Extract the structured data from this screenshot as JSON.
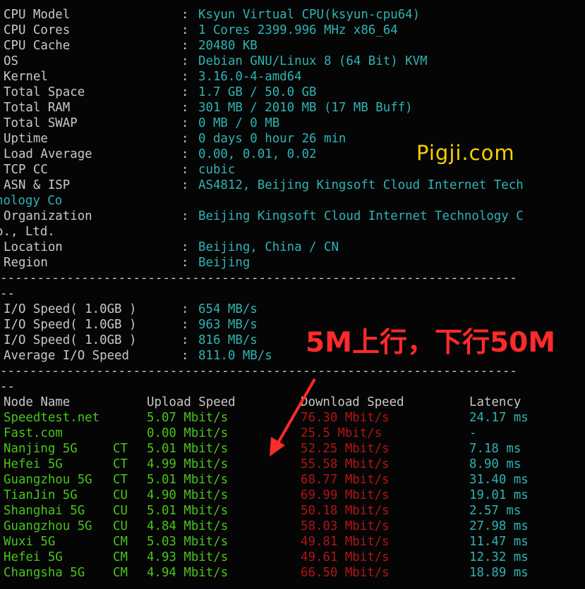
{
  "colors": {
    "background": "#050505",
    "label": "#c8c8c8",
    "value": "#2fb3b3",
    "upload": "#48c51a",
    "download": "#b31414",
    "latency": "#2fb3b3",
    "watermark": "#f6d000",
    "annotation": "#ff2a2a"
  },
  "top_partial": "--",
  "system_info": [
    {
      "label": "CPU Model",
      "value": "Ksyun Virtual CPU(ksyun-cpu64)"
    },
    {
      "label": "CPU Cores",
      "value": "1 Cores 2399.996 MHz x86_64"
    },
    {
      "label": "CPU Cache",
      "value": "20480 KB"
    },
    {
      "label": "OS",
      "value": "Debian GNU/Linux 8 (64 Bit) KVM"
    },
    {
      "label": "Kernel",
      "value": "3.16.0-4-amd64"
    },
    {
      "label": "Total Space",
      "value": "1.7 GB / 50.0 GB"
    },
    {
      "label": "Total RAM",
      "value": "301 MB / 2010 MB (17 MB Buff)"
    },
    {
      "label": "Total SWAP",
      "value": "0 MB / 0 MB"
    },
    {
      "label": "Uptime",
      "value": "0 days 0 hour 26 min"
    },
    {
      "label": "Load Average",
      "value": "0.00, 0.01, 0.02"
    },
    {
      "label": "TCP CC",
      "value": "cubic"
    }
  ],
  "asn": {
    "label": "ASN & ISP",
    "value": "AS4812, Beijing Kingsoft Cloud Internet Tech",
    "wrap": "nology Co"
  },
  "org": {
    "label": "Organization",
    "value": "Beijing Kingsoft Cloud Internet Technology C",
    "wrap": "o., Ltd."
  },
  "location": {
    "label": "Location",
    "value": "Beijing, China / CN"
  },
  "region": {
    "label": "Region",
    "value": "Beijing"
  },
  "separator": "----------------------------------------------------------------------",
  "separator_tail": "--",
  "io": [
    {
      "label": "I/O Speed( 1.0GB )",
      "value": "654 MB/s"
    },
    {
      "label": "I/O Speed( 1.0GB )",
      "value": "963 MB/s"
    },
    {
      "label": "I/O Speed( 1.0GB )",
      "value": "816 MB/s"
    },
    {
      "label": "Average I/O Speed",
      "value": "811.0 MB/s"
    }
  ],
  "speed_headers": {
    "node": "Node Name",
    "upload": "Upload Speed",
    "download": "Download Speed",
    "latency": "Latency"
  },
  "speed_rows": [
    {
      "node": "Speedtest.net",
      "isp": "",
      "upload": "5.07 Mbit/s",
      "download": "76.30 Mbit/s",
      "latency": "24.17 ms"
    },
    {
      "node": "Fast.com",
      "isp": "",
      "upload": "0.00 Mbit/s",
      "download": "25.5 Mbit/s",
      "latency": "-"
    },
    {
      "node": "Nanjing 5G",
      "isp": "CT",
      "upload": "5.01 Mbit/s",
      "download": "52.25 Mbit/s",
      "latency": "7.18 ms"
    },
    {
      "node": "Hefei 5G",
      "isp": "CT",
      "upload": "4.99 Mbit/s",
      "download": "55.58 Mbit/s",
      "latency": "8.90 ms"
    },
    {
      "node": "Guangzhou 5G",
      "isp": "CT",
      "upload": "5.01 Mbit/s",
      "download": "68.77 Mbit/s",
      "latency": "31.40 ms"
    },
    {
      "node": "TianJin 5G",
      "isp": "CU",
      "upload": "4.90 Mbit/s",
      "download": "69.99 Mbit/s",
      "latency": "19.01 ms"
    },
    {
      "node": "Shanghai 5G",
      "isp": "CU",
      "upload": "5.01 Mbit/s",
      "download": "50.18 Mbit/s",
      "latency": "2.57 ms"
    },
    {
      "node": "Guangzhou 5G",
      "isp": "CU",
      "upload": "4.84 Mbit/s",
      "download": "58.03 Mbit/s",
      "latency": "27.98 ms"
    },
    {
      "node": "Wuxi 5G",
      "isp": "CM",
      "upload": "5.03 Mbit/s",
      "download": "49.81 Mbit/s",
      "latency": "11.47 ms"
    },
    {
      "node": "Hefei 5G",
      "isp": "CM",
      "upload": "4.93 Mbit/s",
      "download": "49.61 Mbit/s",
      "latency": "12.32 ms"
    },
    {
      "node": "Changsha 5G",
      "isp": "CM",
      "upload": "4.94 Mbit/s",
      "download": "66.50 Mbit/s",
      "latency": "18.89 ms"
    }
  ],
  "watermark": "Pigji.com",
  "annotation": "5M上行，下行50M",
  "arrow_icon": "arrow-down-left-icon"
}
